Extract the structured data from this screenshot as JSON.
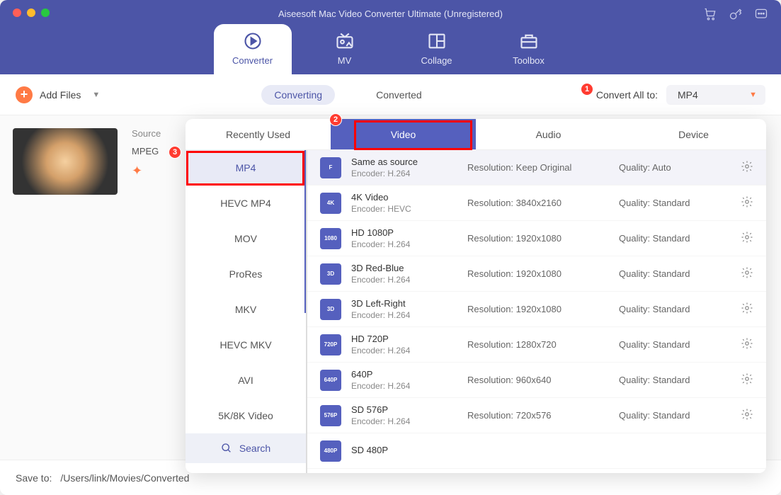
{
  "window": {
    "title": "Aiseesoft Mac Video Converter Ultimate (Unregistered)"
  },
  "main_tabs": {
    "converter": "Converter",
    "mv": "MV",
    "collage": "Collage",
    "toolbox": "Toolbox"
  },
  "toolbar": {
    "add_files": "Add Files",
    "converting": "Converting",
    "converted": "Converted",
    "convert_all_to": "Convert All to:",
    "format": "MP4"
  },
  "file": {
    "source_label": "Source",
    "format": "MPEG"
  },
  "footer": {
    "save_to": "Save to:",
    "path": "/Users/link/Movies/Converted"
  },
  "popup": {
    "tabs": {
      "recently": "Recently Used",
      "video": "Video",
      "audio": "Audio",
      "device": "Device"
    },
    "formats": [
      "MP4",
      "HEVC MP4",
      "MOV",
      "ProRes",
      "MKV",
      "HEVC MKV",
      "AVI",
      "5K/8K Video"
    ],
    "search": "Search",
    "res_label": "Resolution: ",
    "qual_label": "Quality: ",
    "enc_label": "Encoder: ",
    "presets": [
      {
        "name": "Same as source",
        "encoder": "H.264",
        "resolution": "Keep Original",
        "quality": "Auto",
        "icon": "F"
      },
      {
        "name": "4K Video",
        "encoder": "HEVC",
        "resolution": "3840x2160",
        "quality": "Standard",
        "icon": "4K"
      },
      {
        "name": "HD 1080P",
        "encoder": "H.264",
        "resolution": "1920x1080",
        "quality": "Standard",
        "icon": "1080"
      },
      {
        "name": "3D Red-Blue",
        "encoder": "H.264",
        "resolution": "1920x1080",
        "quality": "Standard",
        "icon": "3D"
      },
      {
        "name": "3D Left-Right",
        "encoder": "H.264",
        "resolution": "1920x1080",
        "quality": "Standard",
        "icon": "3D"
      },
      {
        "name": "HD 720P",
        "encoder": "H.264",
        "resolution": "1280x720",
        "quality": "Standard",
        "icon": "720P"
      },
      {
        "name": "640P",
        "encoder": "H.264",
        "resolution": "960x640",
        "quality": "Standard",
        "icon": "640P"
      },
      {
        "name": "SD 576P",
        "encoder": "H.264",
        "resolution": "720x576",
        "quality": "Standard",
        "icon": "576P"
      },
      {
        "name": "SD 480P",
        "encoder": "",
        "resolution": "",
        "quality": "",
        "icon": "480P"
      }
    ]
  },
  "callouts": [
    "1",
    "2",
    "3"
  ]
}
